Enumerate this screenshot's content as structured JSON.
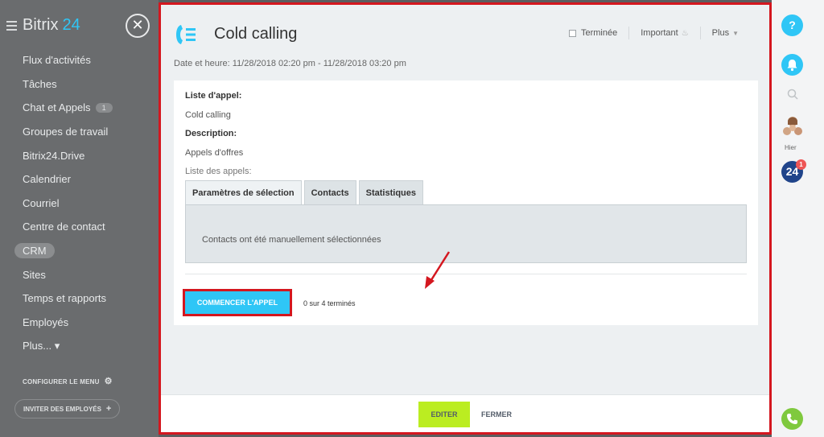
{
  "sidebar": {
    "logo_text": "Bitrix",
    "logo_num": "24",
    "close_glyph": "✕",
    "items": [
      {
        "label": "Flux d'activités"
      },
      {
        "label": "Tâches"
      },
      {
        "label": "Chat et Appels",
        "badge": "1"
      },
      {
        "label": "Groupes de travail"
      },
      {
        "label": "Bitrix24.Drive"
      },
      {
        "label": "Calendrier"
      },
      {
        "label": "Courriel"
      },
      {
        "label": "Centre de contact"
      },
      {
        "label": "CRM",
        "active": true
      },
      {
        "label": "Sites"
      },
      {
        "label": "Temps et rapports"
      },
      {
        "label": "Employés"
      },
      {
        "label": "Plus... ▾"
      }
    ],
    "configure_label": "CONFIGURER LE MENU",
    "invite_label": "INVITER DES EMPLOYÉS"
  },
  "panel": {
    "title": "Cold calling",
    "actions": {
      "done_label": "Terminée",
      "important_label": "Important",
      "more_label": "Plus"
    },
    "dateline": "Date et heure:  11/28/2018 02:20 pm - 11/28/2018 03:20 pm",
    "call_list_label": "Liste d'appel:",
    "call_list_value": "Cold calling",
    "description_label": "Description:",
    "description_value": "Appels d'offres",
    "calls_list_label": "Liste des appels:",
    "tabs": [
      {
        "label": "Paramètres de sélection",
        "active": true
      },
      {
        "label": "Contacts"
      },
      {
        "label": "Statistiques"
      }
    ],
    "tab_message": "Contacts ont été manuellement sélectionnées",
    "start_button": "COMMENCER L'APPEL",
    "progress_text": "0 sur 4 terminés",
    "footer": {
      "edit_label": "EDITER",
      "close_label": "FERMER"
    }
  },
  "rightbar": {
    "help_glyph": "?",
    "hier_label": "Hier",
    "app_label": "24",
    "notif_count": "1"
  },
  "colors": {
    "accent_blue": "#2fc6f6",
    "highlight_red": "#d4171f",
    "edit_green": "#bbed21",
    "call_green": "#7fc93e"
  },
  "icons": [
    "menu-icon",
    "close-icon",
    "phone-list-icon",
    "checkbox-icon",
    "flame-icon",
    "chevron-down-icon",
    "gear-icon",
    "plus-icon",
    "help-icon",
    "bell-icon",
    "search-icon",
    "avatars-icon",
    "phone-icon"
  ]
}
